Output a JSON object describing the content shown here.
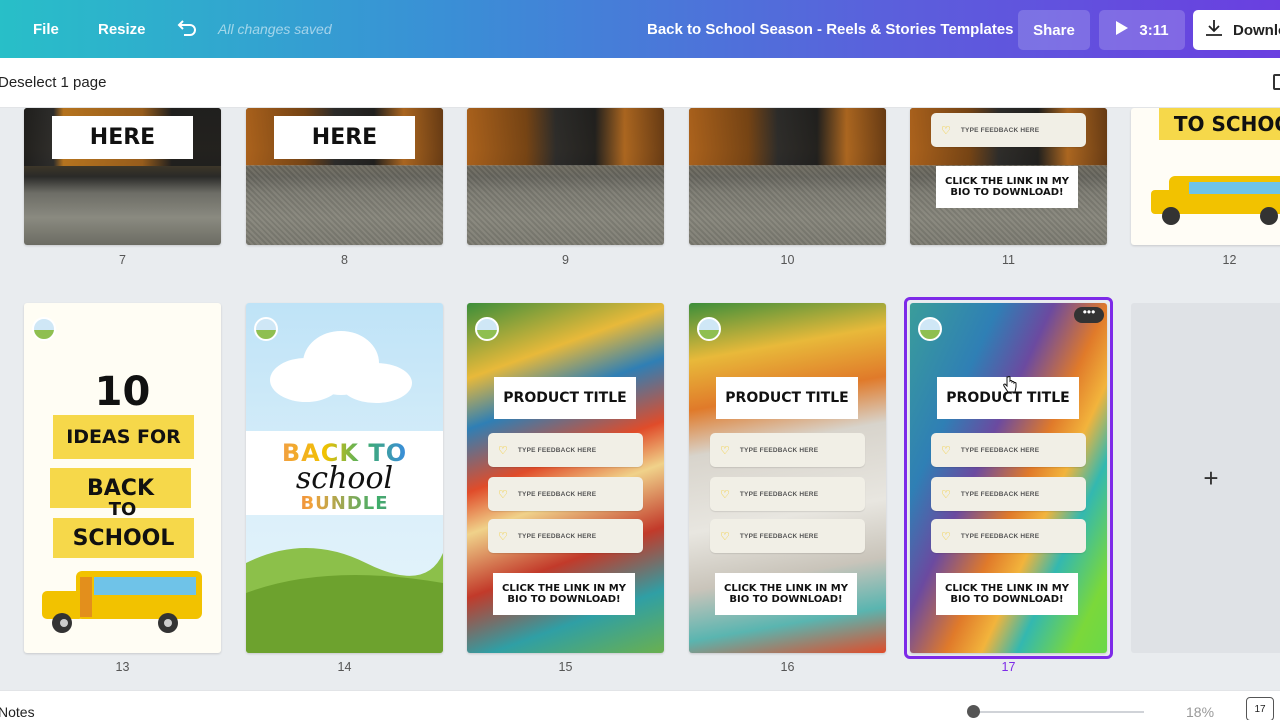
{
  "topbar": {
    "file": "File",
    "resize": "Resize",
    "saved": "All changes saved",
    "title": "Back to School Season - Reels & Stories Templates",
    "share": "Share",
    "present_time": "3:11",
    "download": "Download"
  },
  "subbar": {
    "deselect": "Deselect 1 page"
  },
  "pages_row1": [
    {
      "num": "7",
      "label": "HERE"
    },
    {
      "num": "8",
      "label": "HERE"
    },
    {
      "num": "9"
    },
    {
      "num": "10"
    },
    {
      "num": "11",
      "feedback": "TYPE FEEDBACK HERE",
      "click": "CLICK THE LINK IN MY BIO TO DOWNLOAD!"
    },
    {
      "num": "12",
      "label": "TO SCHOOL"
    }
  ],
  "page13": {
    "num": "13",
    "big": "10",
    "line1": "IDEAS FOR",
    "line2": "BACK",
    "line3": "TO",
    "line4": "SCHOOL"
  },
  "page14": {
    "num": "14",
    "back": "BACK TO",
    "school": "school",
    "bundle": "BUNDLE"
  },
  "product_pages": [
    {
      "num": "15",
      "title": "PRODUCT TITLE",
      "feedback": [
        "TYPE FEEDBACK HERE",
        "TYPE FEEDBACK HERE",
        "TYPE FEEDBACK HERE"
      ],
      "click": "CLICK THE LINK IN MY BIO TO DOWNLOAD!"
    },
    {
      "num": "16",
      "title": "PRODUCT TITLE",
      "feedback": [
        "TYPE FEEDBACK HERE",
        "TYPE FEEDBACK HERE",
        "TYPE FEEDBACK HERE"
      ],
      "click": "CLICK THE LINK IN MY BIO TO DOWNLOAD!"
    },
    {
      "num": "17",
      "title": "PRODUCT TITLE",
      "feedback": [
        "TYPE FEEDBACK HERE",
        "TYPE FEEDBACK HERE",
        "TYPE FEEDBACK HERE"
      ],
      "click": "CLICK THE LINK IN MY BIO TO DOWNLOAD!"
    }
  ],
  "add_page": "+",
  "bottombar": {
    "notes": "Notes",
    "zoom": "18%",
    "page_count": "17"
  },
  "colors": {
    "selected": "#7d2ae8",
    "accent": "#f6d84a"
  }
}
